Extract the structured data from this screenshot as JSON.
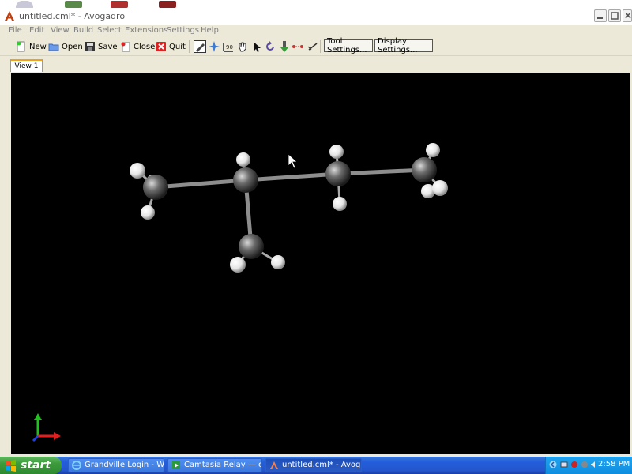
{
  "window": {
    "title": "untitled.cml* - Avogadro",
    "controls": [
      "minimize",
      "maximize",
      "close"
    ]
  },
  "menubar": {
    "items": [
      "File",
      "Edit",
      "View",
      "Build",
      "Select",
      "Extensions",
      "Settings",
      "Help"
    ]
  },
  "toolbar": {
    "buttons": [
      {
        "label": "New",
        "icon": "new-document-icon"
      },
      {
        "label": "Open",
        "icon": "open-folder-icon"
      },
      {
        "label": "Save",
        "icon": "floppy-disk-icon"
      },
      {
        "label": "Close",
        "icon": "close-document-icon"
      },
      {
        "label": "Quit",
        "icon": "quit-icon"
      }
    ],
    "tools": [
      "draw-pencil-icon",
      "navigate-icon",
      "bond-centric-icon",
      "manipulate-hand-icon",
      "select-arrow-icon",
      "auto-rotate-icon",
      "auto-optimize-icon",
      "measure-icon",
      "align-icon"
    ],
    "tool_settings_label": "Tool Settings...",
    "display_settings_label": "Display Settings..."
  },
  "tabs": [
    {
      "label": "View 1",
      "active": true
    }
  ],
  "viewport": {
    "background": "#000000",
    "molecule": {
      "atoms": [
        {
          "element": "C"
        },
        {
          "element": "C"
        },
        {
          "element": "C"
        },
        {
          "element": "C"
        },
        {
          "element": "C"
        },
        {
          "element": "H"
        },
        {
          "element": "H"
        },
        {
          "element": "H"
        },
        {
          "element": "H"
        },
        {
          "element": "H"
        },
        {
          "element": "H"
        },
        {
          "element": "H"
        },
        {
          "element": "H"
        },
        {
          "element": "H"
        },
        {
          "element": "H"
        },
        {
          "element": "H"
        },
        {
          "element": "H"
        }
      ]
    },
    "axes_colors": {
      "x": "#e02020",
      "y": "#20c020",
      "z": "#2040e0"
    }
  },
  "taskbar": {
    "start_label": "start",
    "tasks": [
      {
        "label": "Grandville Login - Win...",
        "icon": "ie-icon"
      },
      {
        "label": "Camtasia Relay — cg...",
        "icon": "camtasia-icon"
      },
      {
        "label": "untitled.cml* - Avoga...",
        "icon": "avogadro-icon",
        "active": true
      }
    ],
    "clock": "2:58 PM"
  },
  "colors": {
    "taskbar_blue": "#245edb",
    "start_green": "#3c9a3c",
    "carbon": "#6e6e6e",
    "hydrogen": "#f0f0f0"
  }
}
